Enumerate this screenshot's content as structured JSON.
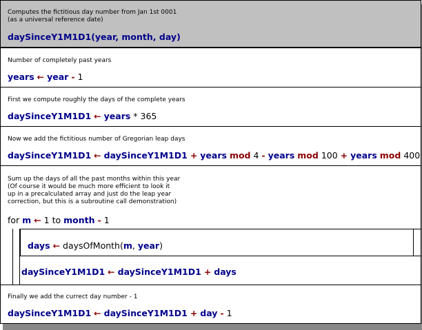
{
  "header": {
    "comment": "Computes the fictitious day number from Jan 1st 0001\n(as a universal reference date)",
    "signature": {
      "name": "daySinceY1M1D1",
      "open": "(",
      "p1": "year",
      "sep1": ", ",
      "p2": "month",
      "sep2": ", ",
      "p3": "day",
      "close": ")"
    }
  },
  "step1": {
    "comment": "Number of completely past years",
    "lhs": "years",
    "assign": "←",
    "v1": "year",
    "op1": "-",
    "n1": "1"
  },
  "step2": {
    "comment": "First we compute roughly the days of the complete years",
    "lhs": "daySinceY1M1D1",
    "assign": "←",
    "v1": "years",
    "op1": "*",
    "n1": "365"
  },
  "step3": {
    "comment": "Now we add the fictitious number of Gregorian leap days",
    "lhs": "daySinceY1M1D1",
    "assign": "←",
    "v1": "daySinceY1M1D1",
    "op1": "+",
    "v2": "years",
    "mod1": "mod",
    "n1": "4",
    "op2": "-",
    "v3": "years",
    "mod2": "mod",
    "n2": "100",
    "op3": "+",
    "v4": "years",
    "mod3": "mod",
    "n3": "400"
  },
  "loop": {
    "comment": "Sum up the days of all the past months within this year\n(Of course it would be much more efficient to look it\nup in a precalculated array and just do the leap year\ncorrection, but this is a subroutine call demonstration)",
    "kw_for": "for",
    "var": "m",
    "assign": "←",
    "start": "1",
    "kw_to": "to",
    "end_var": "month",
    "op": "-",
    "end_n": "1",
    "body1": {
      "lhs": "days",
      "assign": "←",
      "func": "daysOfMonth(",
      "a1": "m",
      "sep": ", ",
      "a2": "year",
      "close": ")"
    },
    "body2": {
      "lhs": "daySinceY1M1D1",
      "assign": "←",
      "v1": "daySinceY1M1D1",
      "op": "+",
      "v2": "days"
    }
  },
  "step4": {
    "comment": "Finally we add the currect day number - 1",
    "lhs": "daySinceY1M1D1",
    "assign": "←",
    "v1": "daySinceY1M1D1",
    "op1": "+",
    "v2": "day",
    "op2": "-",
    "n1": "1"
  }
}
